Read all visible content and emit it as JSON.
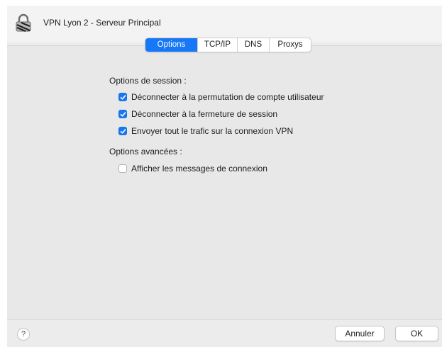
{
  "window": {
    "title": "VPN Lyon 2 - Serveur Principal",
    "icon": "vpn-lock-icon"
  },
  "tabs": [
    {
      "label": "Options",
      "active": true
    },
    {
      "label": "TCP/IP",
      "active": false
    },
    {
      "label": "DNS",
      "active": false
    },
    {
      "label": "Proxys",
      "active": false
    }
  ],
  "session": {
    "label": "Options de session :",
    "options": [
      {
        "label": "Déconnecter à la permutation de compte utilisateur",
        "checked": true
      },
      {
        "label": "Déconnecter à la fermeture de session",
        "checked": true
      },
      {
        "label": "Envoyer tout le trafic sur la connexion VPN",
        "checked": true
      }
    ]
  },
  "advanced": {
    "label": "Options avancées :",
    "options": [
      {
        "label": "Afficher les messages de connexion",
        "checked": false
      }
    ]
  },
  "footer": {
    "help": "?",
    "cancel": "Annuler",
    "ok": "OK"
  },
  "colors": {
    "accent": "#1677f7",
    "panel": "#e8e8e8"
  }
}
